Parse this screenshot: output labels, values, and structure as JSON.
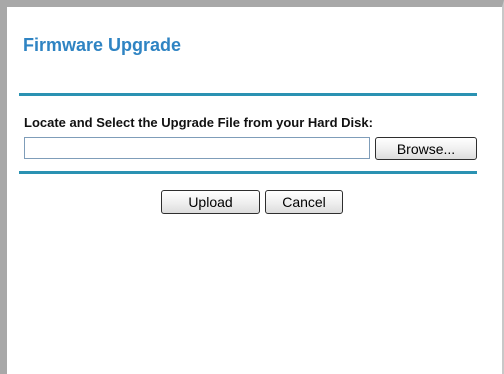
{
  "page": {
    "title": "Firmware Upgrade"
  },
  "form": {
    "file_label": "Locate and Select the Upgrade File from your Hard Disk:",
    "file_value": "",
    "browse_label": "Browse...",
    "upload_label": "Upload",
    "cancel_label": "Cancel"
  },
  "colors": {
    "title": "#2f84c3",
    "rule": "#2a92b2",
    "frame": "#a8a8a8"
  }
}
